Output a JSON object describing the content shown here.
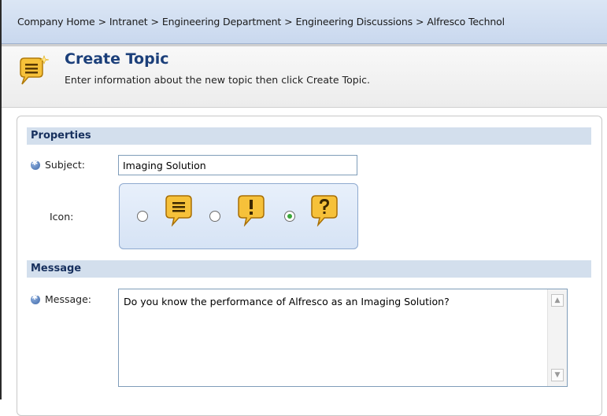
{
  "breadcrumb": {
    "items": [
      "Company Home",
      "Intranet",
      "Engineering Department",
      "Engineering Discussions",
      "Alfresco Technol"
    ],
    "separator": ">"
  },
  "header": {
    "title": "Create Topic",
    "description": "Enter information about the new topic then click Create Topic.",
    "icon": "topic-bubble-icon"
  },
  "properties": {
    "section_title": "Properties",
    "subject_label": "Subject:",
    "subject_value": "Imaging Solution",
    "icon_label": "Icon:",
    "icon_options": [
      {
        "name": "topic-bubble-icon",
        "checked": false
      },
      {
        "name": "topic-exclamation-icon",
        "checked": false
      },
      {
        "name": "topic-question-icon",
        "checked": true
      }
    ]
  },
  "message": {
    "section_title": "Message",
    "message_label": "Message:",
    "message_value": "Do you know the performance of Alfresco as an Imaging Solution?"
  },
  "colors": {
    "breadcrumb_bg": "#c9d8ee",
    "section_bar": "#d3dfed",
    "title_blue": "#1b3f7a",
    "bubble_fill": "#f6c13a"
  }
}
